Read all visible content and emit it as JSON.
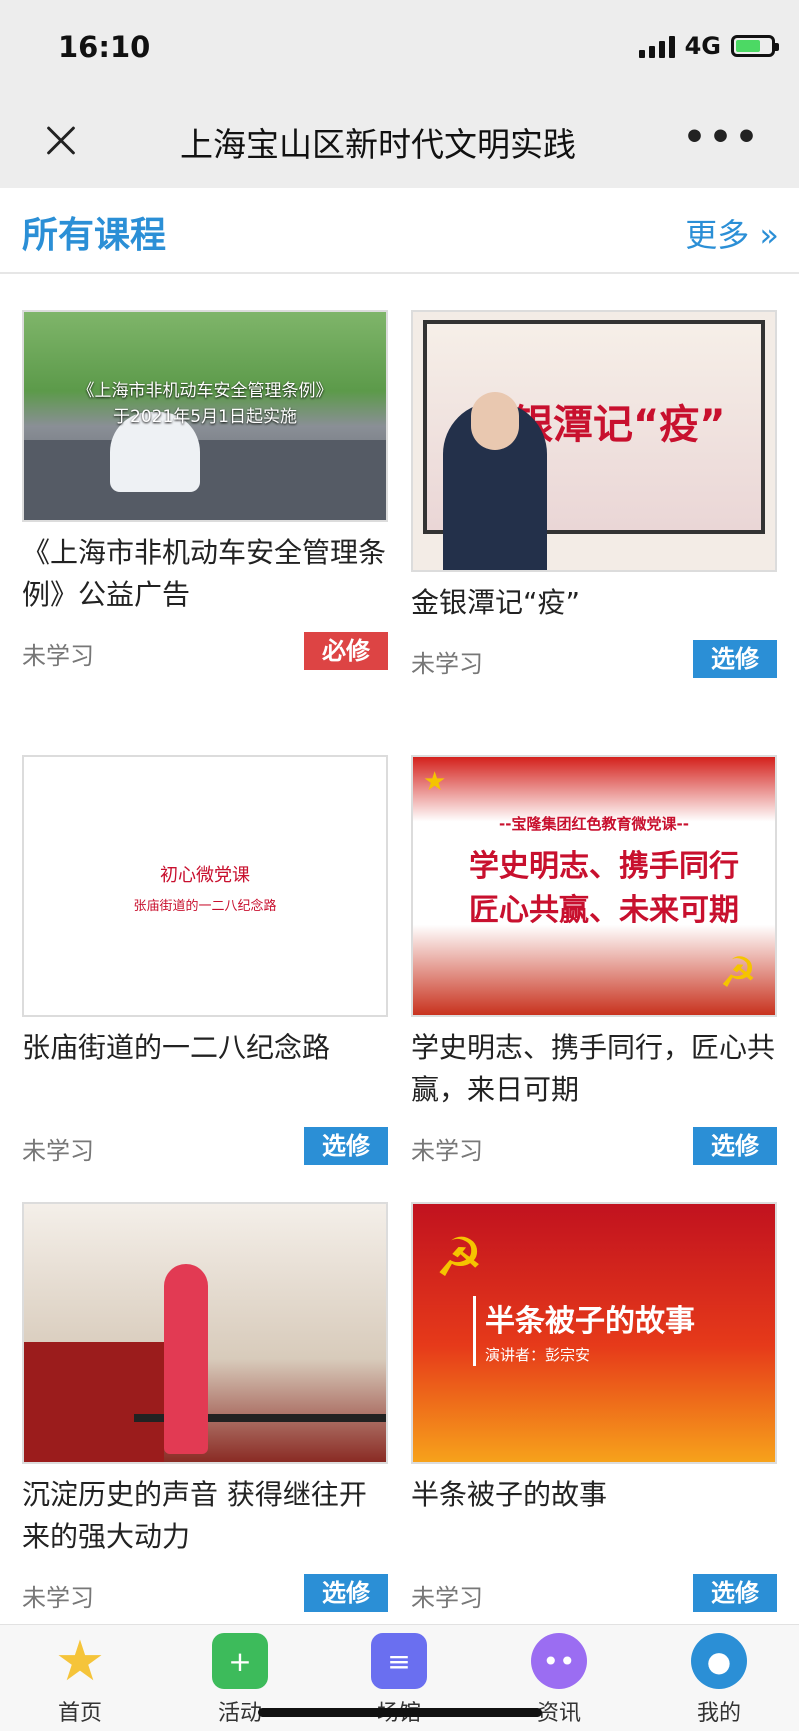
{
  "status_bar": {
    "time": "16:10",
    "network": "4G"
  },
  "header": {
    "title": "上海宝山区新时代文明实践",
    "more": "•••"
  },
  "section": {
    "title": "所有课程",
    "more": "更多 »"
  },
  "courses": [
    {
      "title": "《上海市非机动车安全管理条例》公益广告",
      "status": "未学习",
      "tag": "必修",
      "thumb_caption_1": "《上海市非机动车安全管理条例》",
      "thumb_caption_2": "于2021年5月1日起实施"
    },
    {
      "title": "金银潭记“疫”",
      "status": "未学习",
      "tag": "选修",
      "thumb_caption": "金银潭记“疫”"
    },
    {
      "title": "张庙街道的一二八纪念路",
      "status": "未学习",
      "tag": "选修",
      "thumb_line1": "初心微党课",
      "thumb_line2": "张庙街道的一二八纪念路"
    },
    {
      "title": "学史明志、携手同行，匠心共赢，来日可期",
      "status": "未学习",
      "tag": "选修",
      "thumb_sub": "--宝隆集团红色教育微党课--",
      "thumb_line1": "学史明志、携手同行",
      "thumb_line2": "匠心共赢、未来可期"
    },
    {
      "title": "沉淀历史的声音 获得继往开来的强大动力",
      "status": "未学习",
      "tag": "选修"
    },
    {
      "title": "半条被子的故事",
      "status": "未学习",
      "tag": "选修",
      "thumb_title": "半条被子的故事",
      "thumb_speaker": "演讲者：彭宗安"
    }
  ],
  "tabs": [
    {
      "label": "首页",
      "icon": "star-icon",
      "color": "#f5c43a"
    },
    {
      "label": "活动",
      "icon": "plus-icon",
      "color": "#3dbb5b"
    },
    {
      "label": "场馆",
      "icon": "bookmark-icon",
      "color": "#6a6ff0"
    },
    {
      "label": "资讯",
      "icon": "chat-icon",
      "color": "#9b6df2"
    },
    {
      "label": "我的",
      "icon": "user-icon",
      "color": "#2b8fd6"
    }
  ]
}
